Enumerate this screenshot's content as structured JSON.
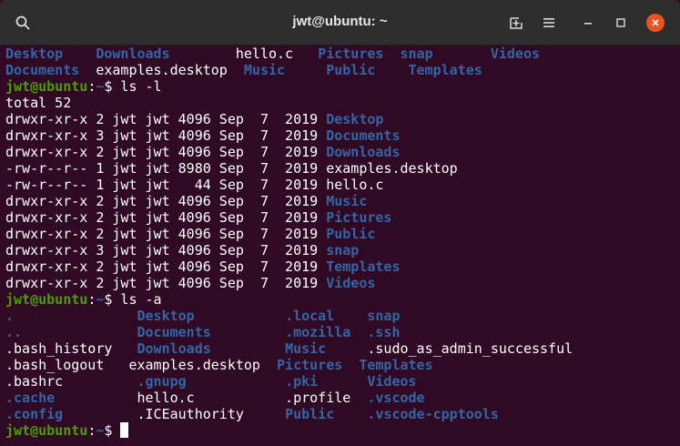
{
  "window": {
    "title": "jwt@ubuntu: ~",
    "icons": [
      "search-icon",
      "new-tab-icon",
      "hamburger-menu-icon",
      "minimize-icon",
      "maximize-icon",
      "close-icon"
    ]
  },
  "terminal": {
    "lines": [
      [
        [
          "blue",
          "Desktop    "
        ],
        [
          "blue",
          "Downloads        "
        ],
        [
          "white",
          "hello.c   "
        ],
        [
          "blue",
          "Pictures  "
        ],
        [
          "blue",
          "snap       "
        ],
        [
          "blue",
          "Videos"
        ]
      ],
      [
        [
          "blue",
          "Documents  "
        ],
        [
          "white",
          "examples.desktop  "
        ],
        [
          "blue",
          "Music     "
        ],
        [
          "blue",
          "Public    "
        ],
        [
          "blue",
          "Templates"
        ]
      ],
      [
        [
          "green",
          "jwt@ubuntu"
        ],
        [
          "white",
          ":"
        ],
        [
          "blue",
          "~"
        ],
        [
          "white",
          "$ ls -l"
        ]
      ],
      [
        [
          "white",
          "total 52"
        ]
      ],
      [
        [
          "white",
          "drwxr-xr-x 2 jwt jwt 4096 Sep  7  2019 "
        ],
        [
          "blue",
          "Desktop"
        ]
      ],
      [
        [
          "white",
          "drwxr-xr-x 3 jwt jwt 4096 Sep  7  2019 "
        ],
        [
          "blue",
          "Documents"
        ]
      ],
      [
        [
          "white",
          "drwxr-xr-x 2 jwt jwt 4096 Sep  7  2019 "
        ],
        [
          "blue",
          "Downloads"
        ]
      ],
      [
        [
          "white",
          "-rw-r--r-- 1 jwt jwt 8980 Sep  7  2019 examples.desktop"
        ]
      ],
      [
        [
          "white",
          "-rw-r--r-- 1 jwt jwt   44 Sep  7  2019 hello.c"
        ]
      ],
      [
        [
          "white",
          "drwxr-xr-x 2 jwt jwt 4096 Sep  7  2019 "
        ],
        [
          "blue",
          "Music"
        ]
      ],
      [
        [
          "white",
          "drwxr-xr-x 2 jwt jwt 4096 Sep  7  2019 "
        ],
        [
          "blue",
          "Pictures"
        ]
      ],
      [
        [
          "white",
          "drwxr-xr-x 2 jwt jwt 4096 Sep  7  2019 "
        ],
        [
          "blue",
          "Public"
        ]
      ],
      [
        [
          "white",
          "drwxr-xr-x 3 jwt jwt 4096 Sep  7  2019 "
        ],
        [
          "blue",
          "snap"
        ]
      ],
      [
        [
          "white",
          "drwxr-xr-x 2 jwt jwt 4096 Sep  7  2019 "
        ],
        [
          "blue",
          "Templates"
        ]
      ],
      [
        [
          "white",
          "drwxr-xr-x 2 jwt jwt 4096 Sep  7  2019 "
        ],
        [
          "blue",
          "Videos"
        ]
      ],
      [
        [
          "green",
          "jwt@ubuntu"
        ],
        [
          "white",
          ":"
        ],
        [
          "blue",
          "~"
        ],
        [
          "white",
          "$ ls -a"
        ]
      ],
      [
        [
          "blue",
          ".               "
        ],
        [
          "blue",
          "Desktop           "
        ],
        [
          "blue",
          ".local    "
        ],
        [
          "blue",
          "snap"
        ]
      ],
      [
        [
          "blue",
          "..              "
        ],
        [
          "blue",
          "Documents         "
        ],
        [
          "blue",
          ".mozilla  "
        ],
        [
          "blue",
          ".ssh"
        ]
      ],
      [
        [
          "white",
          ".bash_history   "
        ],
        [
          "blue",
          "Downloads         "
        ],
        [
          "blue",
          "Music     "
        ],
        [
          "white",
          ".sudo_as_admin_successful"
        ]
      ],
      [
        [
          "white",
          ".bash_logout   examples.desktop  "
        ],
        [
          "blue",
          "Pictures  "
        ],
        [
          "blue",
          "Templates"
        ]
      ],
      [
        [
          "white",
          ".bashrc         "
        ],
        [
          "blue",
          ".gnupg            "
        ],
        [
          "blue",
          ".pki      "
        ],
        [
          "blue",
          "Videos"
        ]
      ],
      [
        [
          "blue",
          ".cache          "
        ],
        [
          "white",
          "hello.c           .profile  "
        ],
        [
          "blue",
          ".vscode"
        ]
      ],
      [
        [
          "blue",
          ".config         "
        ],
        [
          "white",
          ".ICEauthority     "
        ],
        [
          "blue",
          "Public    "
        ],
        [
          "blue",
          ".vscode-cpptools"
        ]
      ],
      [
        [
          "green",
          "jwt@ubuntu"
        ],
        [
          "white",
          ":"
        ],
        [
          "blue",
          "~"
        ],
        [
          "white",
          "$ "
        ]
      ]
    ]
  }
}
